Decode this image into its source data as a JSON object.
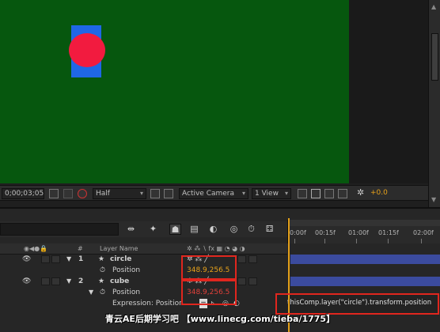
{
  "composition": {
    "background_color": "#06570e",
    "rect_color": "#1f67e6",
    "circle_color": "#f21b3f"
  },
  "viewer_toolbar": {
    "timecode": "0;00;03;05",
    "resolution": "Half",
    "camera": "Active Camera",
    "view_layout": "1 View",
    "exposure": "+0.0"
  },
  "timeline": {
    "column_headers": {
      "number": "#",
      "layer_name": "Layer Name"
    },
    "ruler_ticks": [
      "0:00f",
      "00:15f",
      "01:00f",
      "01:15f",
      "02:00f"
    ],
    "layers": [
      {
        "number": "1",
        "name": "circle",
        "property": "Position",
        "value": "348.9,256.5"
      },
      {
        "number": "2",
        "name": "cube",
        "property": "Position",
        "value": "348.9,256.5"
      }
    ],
    "expression_label": "Expression: Position",
    "expression_text": "thisComp.layer(\"circle\").transform.position",
    "layer_bar_color": "#3b4b9e",
    "highlight_color": "#e0261e"
  },
  "watermark": "青云AE后期学习吧 【www.linecg.com/tieba/1775】"
}
